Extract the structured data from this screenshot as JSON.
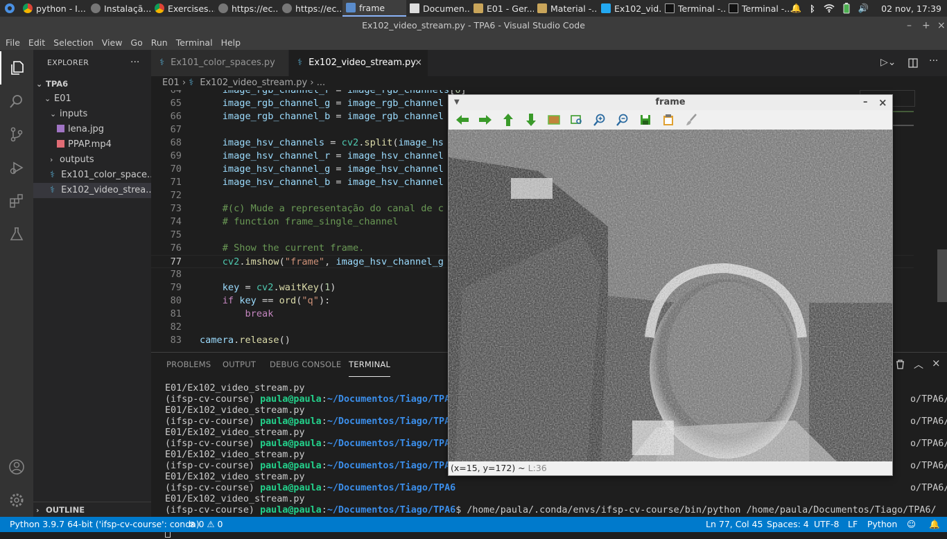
{
  "taskbar": {
    "items": [
      "python - I...",
      "Instalaçã...",
      "Exercises...",
      "https://ec...",
      "https://ec...",
      "frame",
      "Documen...",
      "E01 - Ger...",
      "Material -...",
      "Ex102_vid...",
      "Terminal -...",
      "Terminal -..."
    ],
    "clock": "02 nov, 17:39"
  },
  "window": {
    "title": "Ex102_video_stream.py - TPA6 - Visual Studio Code"
  },
  "menu": [
    "File",
    "Edit",
    "Selection",
    "View",
    "Go",
    "Run",
    "Terminal",
    "Help"
  ],
  "sidebar": {
    "title": "EXPLORER",
    "root": "TPA6",
    "tree": [
      {
        "label": "E01"
      },
      {
        "label": "inputs"
      },
      {
        "label": "lena.jpg"
      },
      {
        "label": "PPAP.mp4"
      },
      {
        "label": "outputs"
      },
      {
        "label": "Ex101_color_space..."
      },
      {
        "label": "Ex102_video_strea..."
      }
    ],
    "outline": "OUTLINE"
  },
  "tabs": [
    {
      "label": "Ex101_color_spaces.py"
    },
    {
      "label": "Ex102_video_stream.py"
    }
  ],
  "breadcrumb": {
    "folder": "E01",
    "file": "Ex102_video_stream.py",
    "more": "..."
  },
  "code": [
    {
      "n": "64",
      "t": "    image_rgb_channel_r = image_rgb_channels[0]"
    },
    {
      "n": "65",
      "t": "    image_rgb_channel_g = image_rgb_channel"
    },
    {
      "n": "66",
      "t": "    image_rgb_channel_b = image_rgb_channel"
    },
    {
      "n": "67",
      "t": ""
    },
    {
      "n": "68",
      "t": "    image_hsv_channels = cv2.split(image_hs"
    },
    {
      "n": "69",
      "t": "    image_hsv_channel_r = image_hsv_channel"
    },
    {
      "n": "70",
      "t": "    image_hsv_channel_g = image_hsv_channel"
    },
    {
      "n": "71",
      "t": "    image_hsv_channel_b = image_hsv_channel"
    },
    {
      "n": "72",
      "t": ""
    },
    {
      "n": "73",
      "t": "    #(c) Mude a representação do canal de c"
    },
    {
      "n": "74",
      "t": "    # function frame_single_channel"
    },
    {
      "n": "75",
      "t": ""
    },
    {
      "n": "76",
      "t": "    # Show the current frame."
    },
    {
      "n": "77",
      "t": "    cv2.imshow(\"frame\", image_hsv_channel_g"
    },
    {
      "n": "78",
      "t": ""
    },
    {
      "n": "79",
      "t": "    key = cv2.waitKey(1)"
    },
    {
      "n": "80",
      "t": "    if key == ord(\"q\"):"
    },
    {
      "n": "81",
      "t": "        break"
    },
    {
      "n": "82",
      "t": ""
    },
    {
      "n": "83",
      "t": "camera.release()"
    }
  ],
  "panel": {
    "tabs": [
      "PROBLEMS",
      "OUTPUT",
      "DEBUG CONSOLE",
      "TERMINAL"
    ],
    "terminal": {
      "first": "E01/Ex102_video_stream.py",
      "env": "(ifsp-cv-course) ",
      "user": "paula@paula",
      "colon": ":",
      "path": "~/Documentos/Tiago/TPA6",
      "cmd": "$ /home/paula/.conda/envs/ifsp-cv-course/bin/python /home/paula/Documentos/Tiago/TPA6/",
      "cont": "E01/Ex102_video_stream.py",
      "right_tail": "o/TPA6/"
    }
  },
  "frame_window": {
    "title": "frame",
    "status": "(x=15, y=172) ~ ",
    "status_extra": "L:36"
  },
  "statusbar": {
    "python": "Python 3.9.7 64-bit ('ifsp-cv-course': conda)",
    "problems": "⊗ 0 ⚠ 0",
    "position": "Ln 77, Col 45",
    "spaces": "Spaces: 4",
    "encoding": "UTF-8",
    "eol": "LF",
    "language": "Python"
  },
  "colors": {
    "accent": "#007acc",
    "keyword": "#c586c0",
    "function": "#dcdcaa",
    "string": "#ce9178",
    "comment": "#6a9955",
    "number": "#b5cea8"
  }
}
